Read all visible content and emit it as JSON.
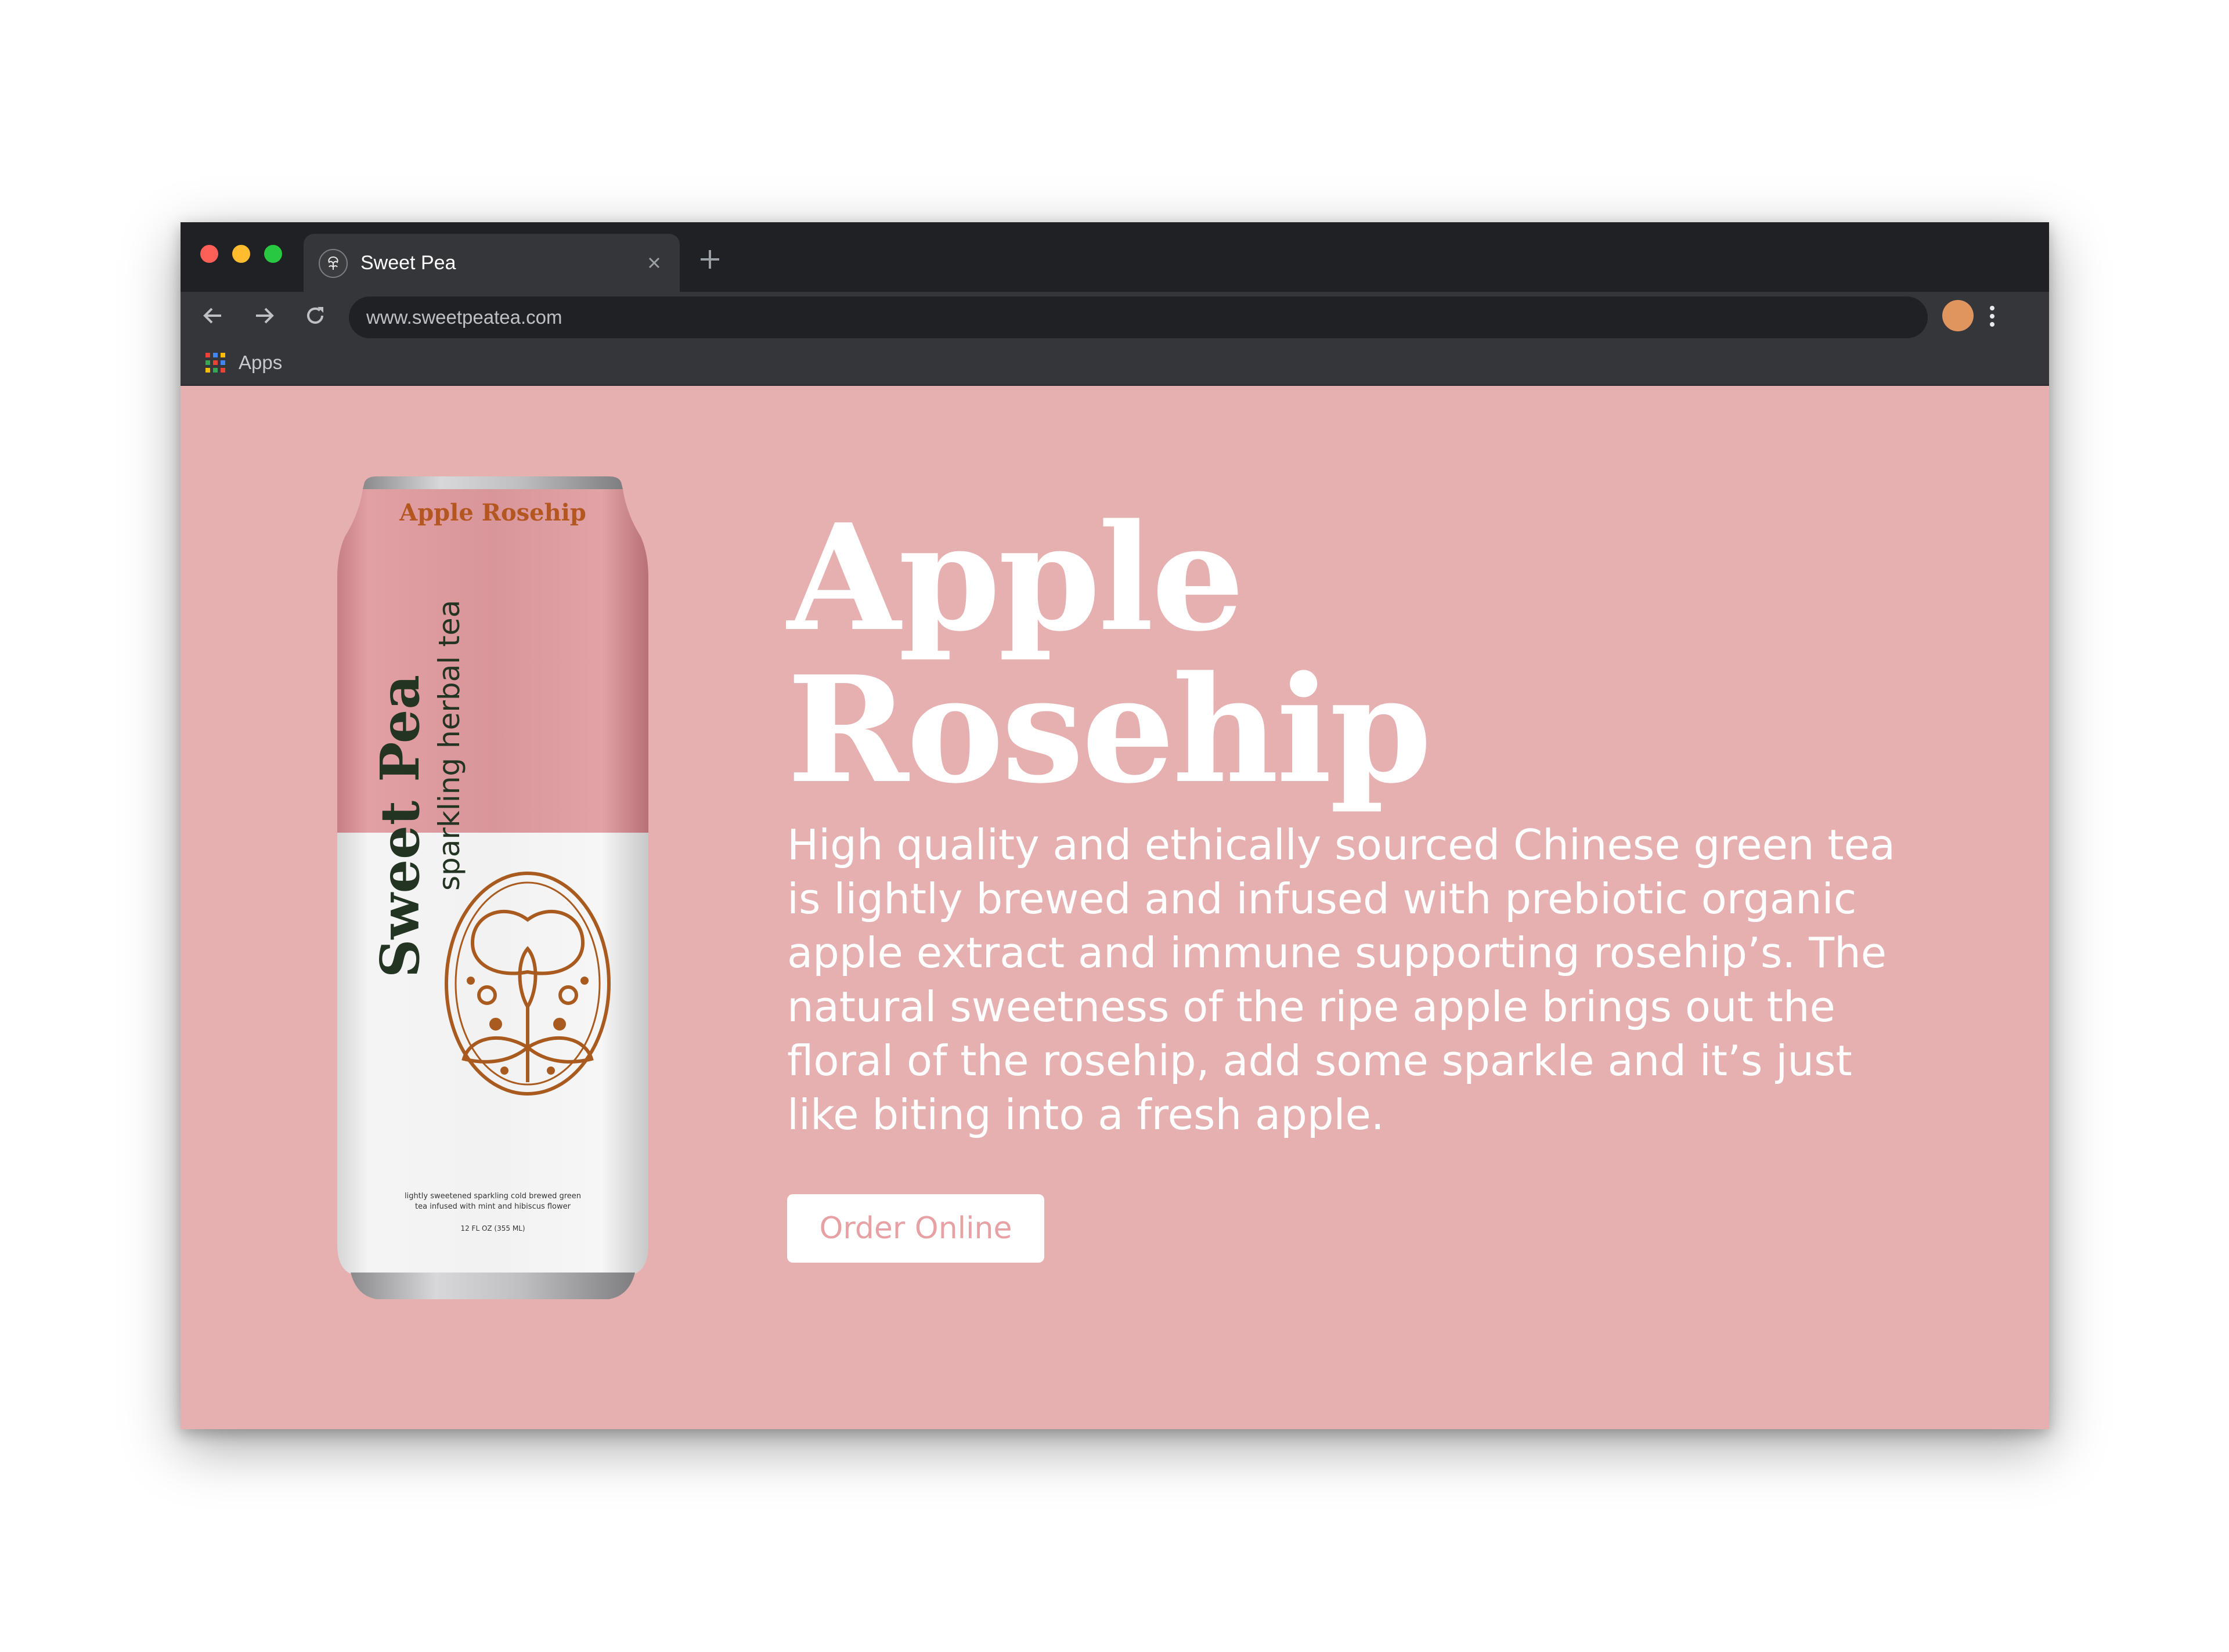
{
  "browser": {
    "window_controls": {
      "close_color": "#fe5f57",
      "minimize_color": "#febc2e",
      "maximize_color": "#28c840"
    },
    "tab": {
      "title": "Sweet Pea",
      "favicon": "sweet-pea-logo-icon",
      "close_icon": "close-icon"
    },
    "new_tab_icon": "plus-icon",
    "toolbar": {
      "back_icon": "arrow-left-icon",
      "forward_icon": "arrow-right-icon",
      "reload_icon": "reload-icon",
      "url": "www.sweetpeatea.com",
      "profile_avatar_color": "#e0955f",
      "menu_icon": "more-vertical-icon"
    },
    "bookmarks": {
      "apps_icon": "apps-grid-icon",
      "apps_label": "Apps"
    }
  },
  "page": {
    "background_color": "#e7b0b0",
    "product_image": {
      "flavor_label": "Apple Rosehip",
      "brand": "Sweet Pea",
      "subtitle": "sparkling herbal tea",
      "small_print_line1": "lightly sweetened sparkling cold brewed green",
      "small_print_line2": "tea infused with mint and hibiscus flower",
      "volume": "12 FL OZ (355 ML)"
    },
    "headline_line1": "Apple",
    "headline_line2": "Rosehip",
    "description": "High quality and ethically sourced Chinese green tea is lightly brewed and infused with prebiotic organic apple extract and immune supporting rosehip’s. The natural sweetness of the ripe apple brings out the floral of the rosehip, add some sparkle and it’s just like biting into a fresh apple.",
    "cta_label": "Order Online"
  }
}
